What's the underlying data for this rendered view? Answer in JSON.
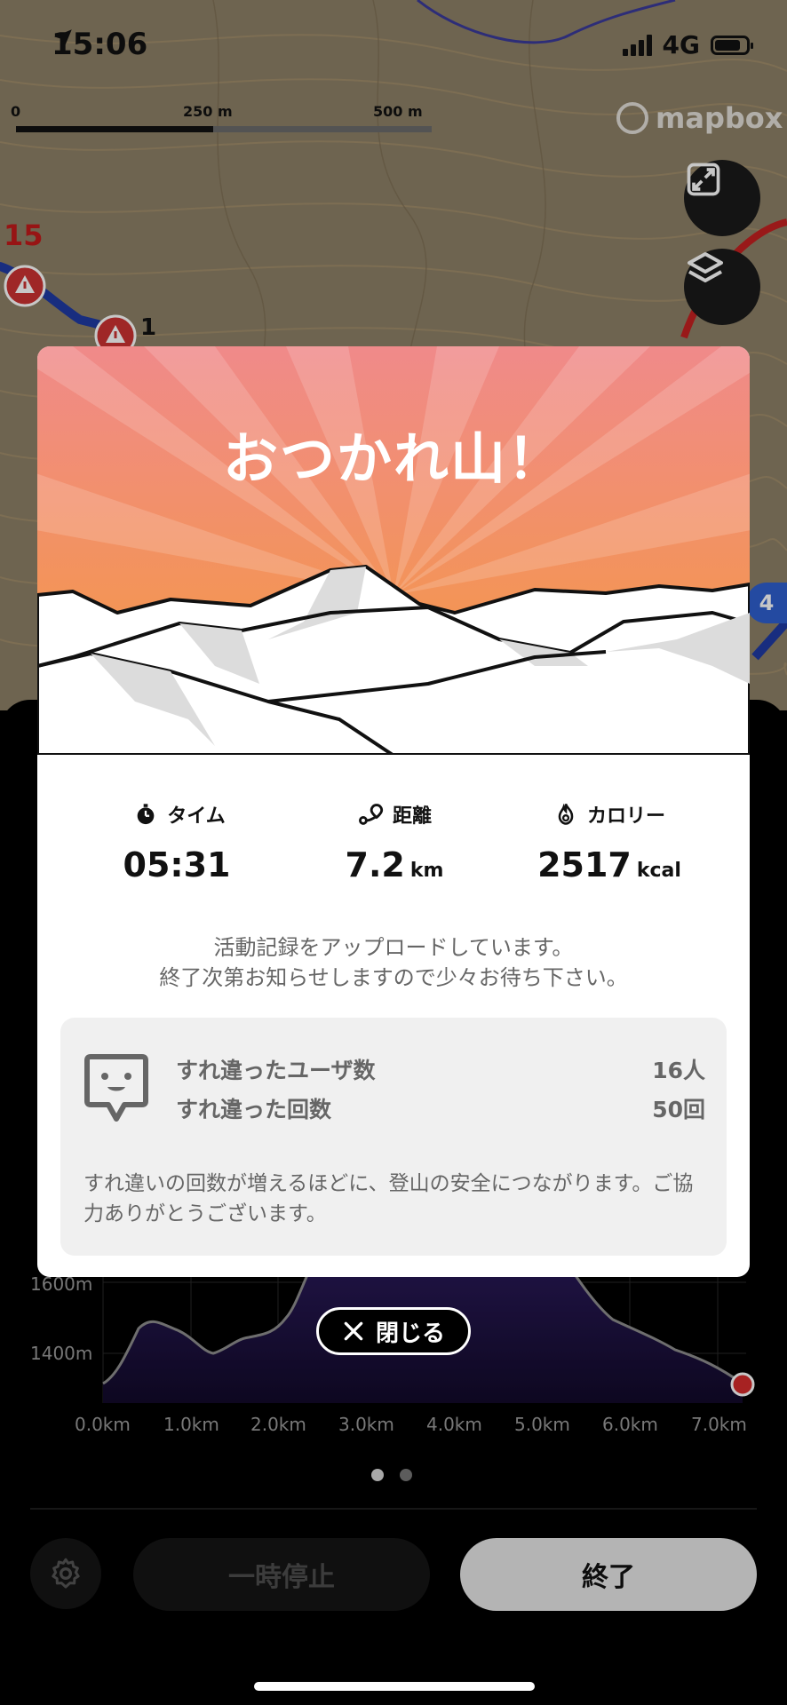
{
  "status_bar": {
    "time": "15:06",
    "network": "4G"
  },
  "map": {
    "scale_labels": [
      "0",
      "250 m",
      "500 m"
    ],
    "attribution": "mapbox",
    "markers": [
      "15",
      "1",
      "4"
    ]
  },
  "modal": {
    "title": "おつかれ山！",
    "stats": {
      "time": {
        "label": "タイム",
        "value": "05:31",
        "unit": ""
      },
      "distance": {
        "label": "距離",
        "value": "7.2",
        "unit": "km"
      },
      "calories": {
        "label": "カロリー",
        "value": "2517",
        "unit": "kcal"
      }
    },
    "upload_message": [
      "活動記録をアップロードしています。",
      "終了次第お知らせしますので少々お待ち下さい。"
    ],
    "encounter": {
      "users_label": "すれ違ったユーザ数",
      "users_value": "16人",
      "count_label": "すれ違った回数",
      "count_value": "50回",
      "note": "すれ違いの回数が増えるほどに、登山の安全につながります。ご協力ありがとうございます。"
    }
  },
  "close_button": {
    "label": "閉じる"
  },
  "elevation": {
    "y_ticks": [
      "1600m",
      "1400m"
    ],
    "x_ticks": [
      "0.0km",
      "1.0km",
      "2.0km",
      "3.0km",
      "4.0km",
      "5.0km",
      "6.0km",
      "7.0km"
    ]
  },
  "controls": {
    "pause_label": "一時停止",
    "end_label": "終了"
  },
  "colors": {
    "hero_top": "#f08a8a",
    "hero_bottom": "#f59a3a",
    "accent_red": "#d62c2c"
  },
  "icons": [
    "location-arrow-icon",
    "expand-icon",
    "layers-icon",
    "stopwatch-icon",
    "route-icon",
    "flame-icon",
    "encounter-face-icon",
    "close-icon",
    "gear-icon"
  ]
}
